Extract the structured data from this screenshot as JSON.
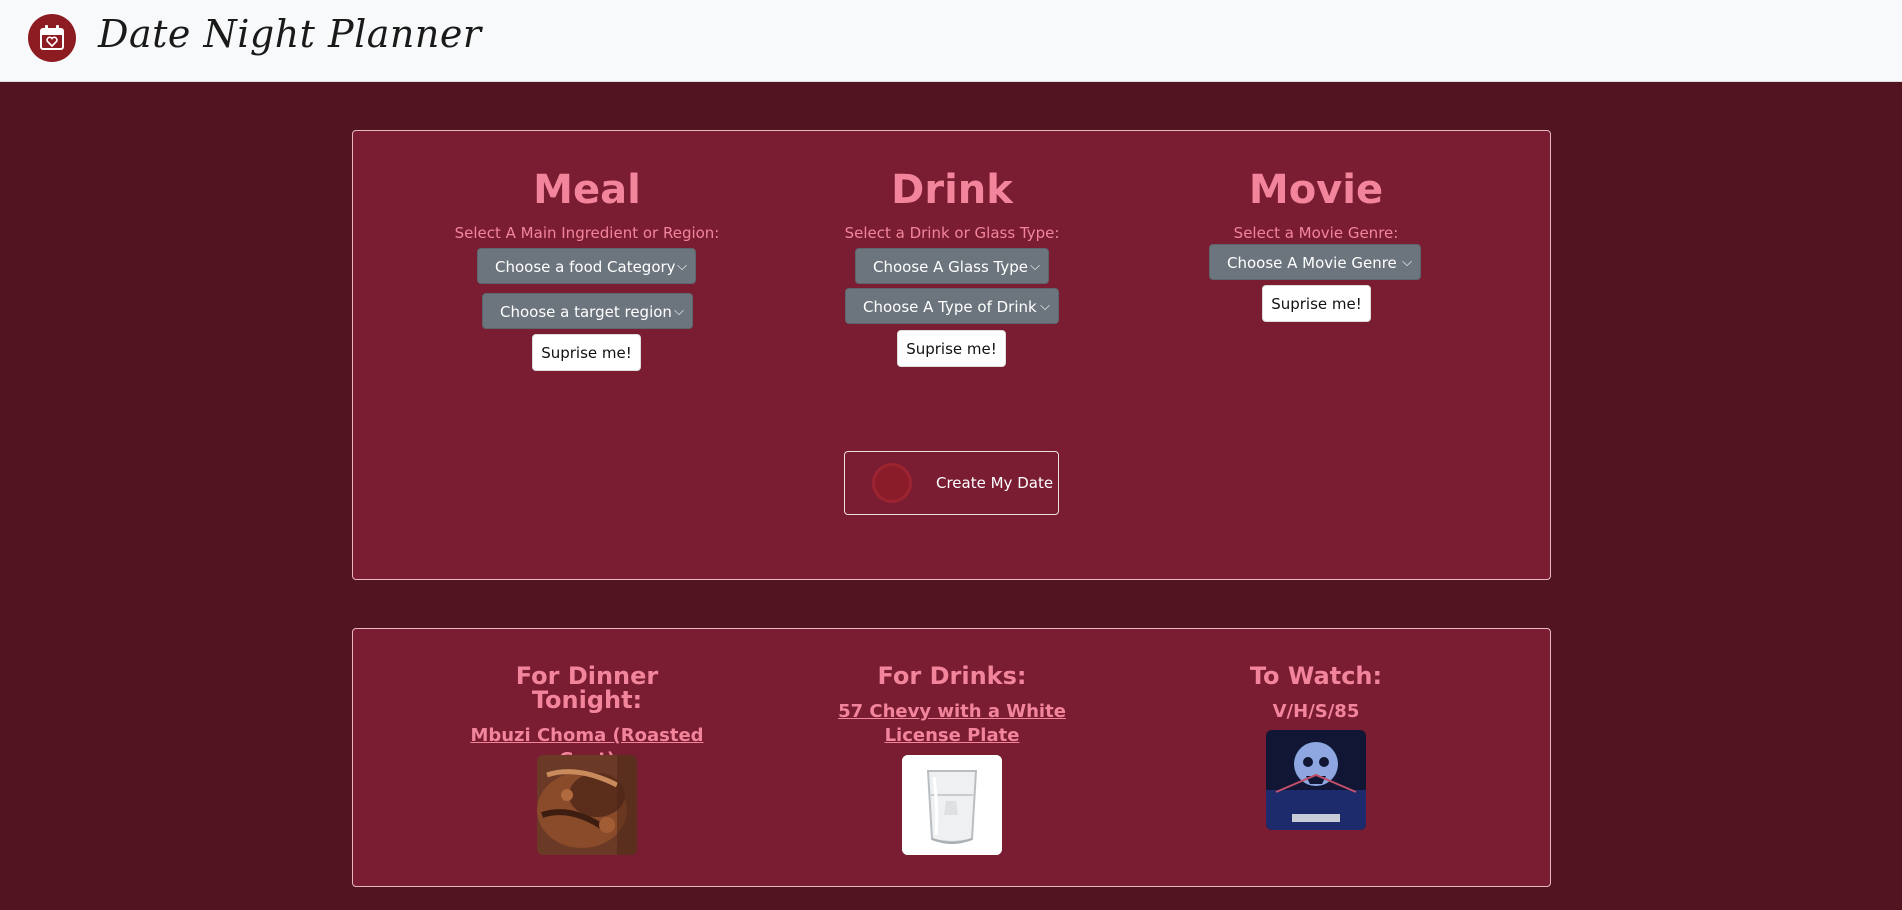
{
  "brand": {
    "title": "Date Night Planner",
    "icon": "calendar-heart-icon"
  },
  "meal": {
    "heading": "Meal",
    "prompt": "Select A Main Ingredient or Region:",
    "category_select": "Choose a food Category",
    "region_select": "Choose a target region",
    "surprise_label": "Suprise me!"
  },
  "drink": {
    "heading": "Drink",
    "prompt": "Select a Drink or Glass Type:",
    "glass_select": "Choose A Glass Type",
    "type_select": "Choose A Type of Drink",
    "surprise_label": "Suprise me!"
  },
  "movie": {
    "heading": "Movie",
    "prompt": "Select a Movie Genre:",
    "genre_select": "Choose A Movie Genre",
    "surprise_label": "Suprise me!"
  },
  "create_button": {
    "label": "Create My Date"
  },
  "results": {
    "dinner": {
      "heading": "For Dinner Tonight:",
      "title": "Mbuzi Choma (Roasted Goat)"
    },
    "drinks": {
      "heading": "For Drinks:",
      "title": "57 Chevy with a White License Plate"
    },
    "watch": {
      "heading": "To Watch:",
      "title": "V/H/S/85"
    }
  },
  "colors": {
    "background": "#521421",
    "panel": "#7a1c32",
    "accent_text": "#f2859c",
    "select_bg": "#6c757d",
    "navbar": "#f8f9fa"
  }
}
